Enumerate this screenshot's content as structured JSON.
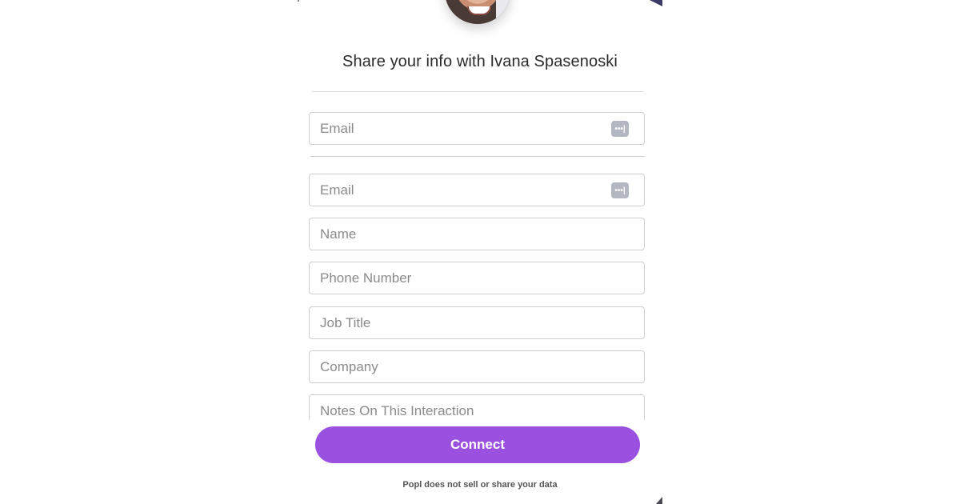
{
  "header": {
    "avatar_alt": "Ivana Spasenoski profile photo",
    "title": "Share your info with Ivana Spasenoski"
  },
  "form": {
    "autofill_email": {
      "placeholder": "Email",
      "value": "",
      "icon": "password-manager-icon"
    },
    "fields": [
      {
        "name": "email",
        "placeholder": "Email",
        "value": "",
        "icon": "password-manager-icon"
      },
      {
        "name": "name",
        "placeholder": "Name",
        "value": ""
      },
      {
        "name": "phone",
        "placeholder": "Phone Number",
        "value": ""
      },
      {
        "name": "job-title",
        "placeholder": "Job Title",
        "value": ""
      },
      {
        "name": "company",
        "placeholder": "Company",
        "value": ""
      },
      {
        "name": "notes",
        "placeholder": "Notes On This Interaction",
        "value": ""
      }
    ],
    "submit_label": "Connect",
    "pw_icon_glyph": "•••|"
  },
  "footer": {
    "privacy_text": "Popl does not sell or share your data"
  },
  "colors": {
    "accent": "#9b51e0",
    "field_border": "#cfcfcf",
    "icon_gray": "#b3b7c2"
  }
}
